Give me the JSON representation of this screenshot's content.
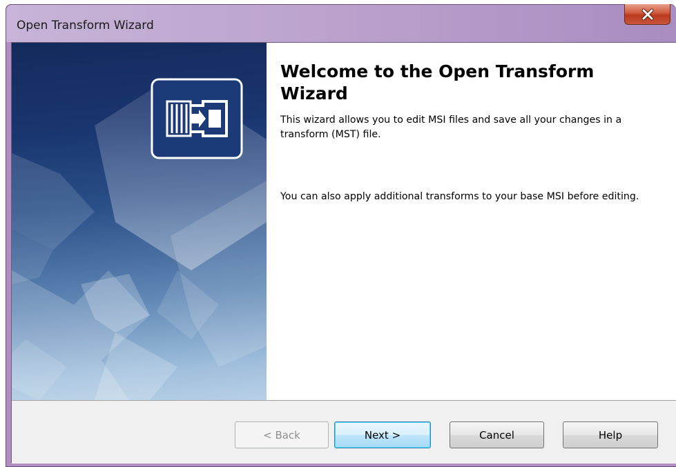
{
  "window": {
    "title": "Open Transform Wizard"
  },
  "close_button": {
    "label": "X"
  },
  "content": {
    "heading": "Welcome to the Open Transform Wizard",
    "paragraph1": "This wizard allows you to edit MSI files and save all your changes in a transform (MST) file.",
    "paragraph2": "You can also apply additional transforms to your base MSI before editing."
  },
  "buttons": {
    "back": "< Back",
    "next": "Next >",
    "cancel": "Cancel",
    "help": "Help"
  },
  "banner": {
    "icon": "transform-wizard-icon"
  },
  "colors": {
    "title_bar": "#bda6cf",
    "banner_dark": "#142a5c",
    "banner_light": "#b8d0e6",
    "close_button": "#c8553a",
    "default_button_border": "#3c7fb1"
  }
}
